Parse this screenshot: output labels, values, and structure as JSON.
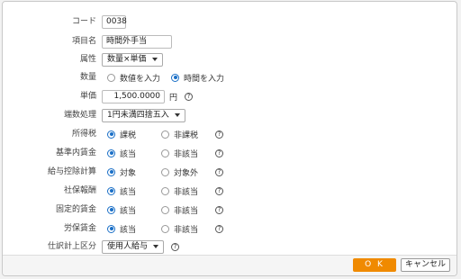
{
  "fields": {
    "code": {
      "label": "コード",
      "value": "0038"
    },
    "item_name": {
      "label": "項目名",
      "value": "時間外手当"
    },
    "attribute": {
      "label": "属性",
      "value": "数量×単価"
    },
    "quantity": {
      "label": "数量",
      "options": [
        "数値を入力",
        "時間を入力"
      ],
      "selected": "時間を入力"
    },
    "unit_price": {
      "label": "単価",
      "value": "1,500.0000",
      "unit": "円"
    },
    "rounding": {
      "label": "端数処理",
      "value": "1円未満四捨五入"
    },
    "income_tax": {
      "label": "所得税",
      "options": [
        "課税",
        "非課税"
      ],
      "selected": "課税"
    },
    "basic_wage": {
      "label": "基準内賃金",
      "options": [
        "該当",
        "非該当"
      ],
      "selected": "該当"
    },
    "payroll_deduction": {
      "label": "給与控除計算",
      "options": [
        "対象",
        "対象外"
      ],
      "selected": "対象"
    },
    "social_insurance": {
      "label": "社保報酬",
      "options": [
        "該当",
        "非該当"
      ],
      "selected": "該当"
    },
    "fixed_wage": {
      "label": "固定的賃金",
      "options": [
        "該当",
        "非該当"
      ],
      "selected": "該当"
    },
    "labor_insurance": {
      "label": "労保賃金",
      "options": [
        "該当",
        "非該当"
      ],
      "selected": "該当"
    },
    "journal_category": {
      "label": "仕訳計上区分",
      "value": "使用人給与"
    }
  },
  "help_glyph": "?",
  "footer": {
    "ok_label": "O K",
    "cancel_label": "キャンセル"
  },
  "colors": {
    "ok_button": "#f08a00",
    "radio_selected": "#1a6fc7"
  }
}
